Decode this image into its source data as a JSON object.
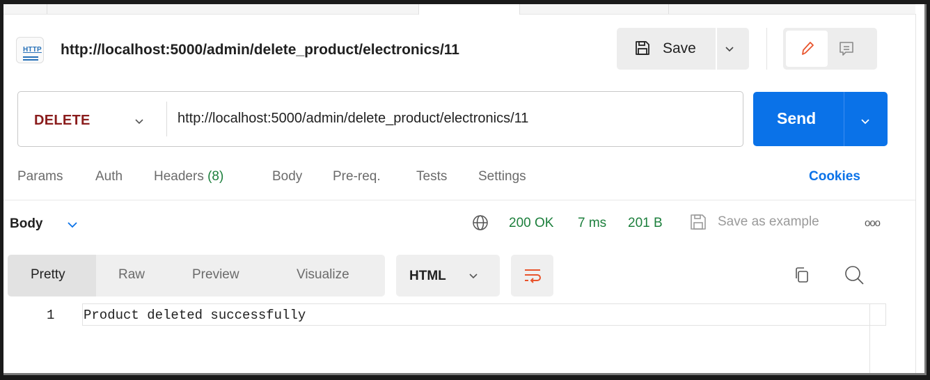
{
  "request": {
    "badge_text": "HTTP",
    "title": "http://localhost:5000/admin/delete_product/electronics/11",
    "save_label": "Save",
    "method": "DELETE",
    "url": "http://localhost:5000/admin/delete_product/electronics/11",
    "send_label": "Send"
  },
  "request_tabs": {
    "params": "Params",
    "auth": "Auth",
    "headers": "Headers",
    "headers_count": "(8)",
    "body": "Body",
    "prereq": "Pre-req.",
    "tests": "Tests",
    "settings": "Settings",
    "cookies": "Cookies"
  },
  "response": {
    "body_label": "Body",
    "status": "200 OK",
    "time": "7 ms",
    "size": "201 B",
    "save_example": "Save as example",
    "more": "ooo",
    "view_tabs": [
      "Pretty",
      "Raw",
      "Preview",
      "Visualize"
    ],
    "format": "HTML",
    "lines": [
      {
        "num": "1",
        "text": "Product deleted successfully"
      }
    ]
  },
  "colors": {
    "accent": "#0a72e8",
    "method_delete": "#8a1c1c",
    "success": "#1c7f3c",
    "edit_icon": "#e8542c"
  },
  "icons": [
    "http-icon",
    "save-icon",
    "chevron-down-icon",
    "pencil-icon",
    "comment-icon",
    "globe-icon",
    "wrap-lines-icon",
    "copy-icon",
    "search-icon"
  ]
}
